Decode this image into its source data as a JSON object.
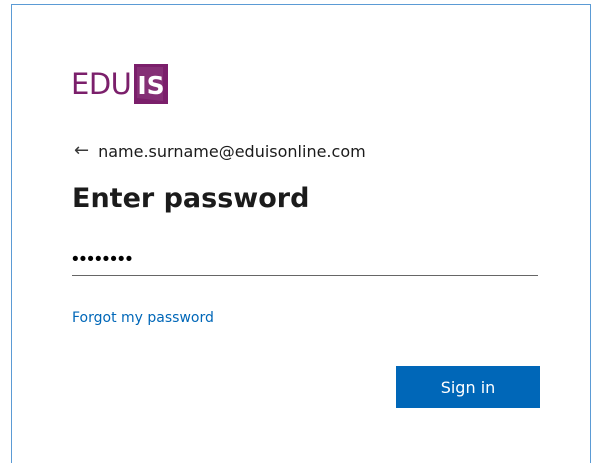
{
  "brand": {
    "logo_text": "EDU",
    "logo_box_text": "IS",
    "primary_color": "#7b1f6b"
  },
  "identity": {
    "back_icon": "left-arrow-icon",
    "email": "name.surname@eduisonline.com"
  },
  "form": {
    "title": "Enter password",
    "password_value": "••••••••",
    "forgot_link": "Forgot my password",
    "submit_label": "Sign in",
    "accent_color": "#0067b8"
  }
}
